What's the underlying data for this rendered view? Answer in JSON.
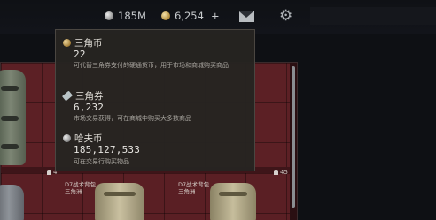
{
  "topbar": {
    "silver_amount": "185M",
    "gold_amount": "6,254",
    "gold_plus": "+",
    "icons": [
      "silver-coin-icon",
      "gold-coin-icon",
      "mail-icon",
      "gear-icon"
    ]
  },
  "inventory": {
    "capacity_left": "4",
    "capacity_right": "45",
    "items": [
      {
        "name_line1": "D7战术背包",
        "name_line2": "三角洲"
      },
      {
        "name_line1": "D7战术背包",
        "name_line2": "三角洲"
      }
    ]
  },
  "tooltip": {
    "currencies": [
      {
        "title": "三角币",
        "value": "22",
        "description": "可代替三角券支付的硬通货币，用于市场和商城购买商品",
        "icon": "triangle-coin-icon"
      },
      {
        "title": "三角券",
        "value": "6,232",
        "description": "市场交易获得，可在商城中购买大多数商品",
        "icon": "triangle-ticket-icon"
      },
      {
        "title": "哈夫币",
        "value": "185,127,533",
        "description": "可在交易行购买物品",
        "icon": "haf-coin-icon"
      }
    ]
  },
  "colors": {
    "inventory_bg": "#5c2025",
    "tooltip_bg": "#262421"
  }
}
